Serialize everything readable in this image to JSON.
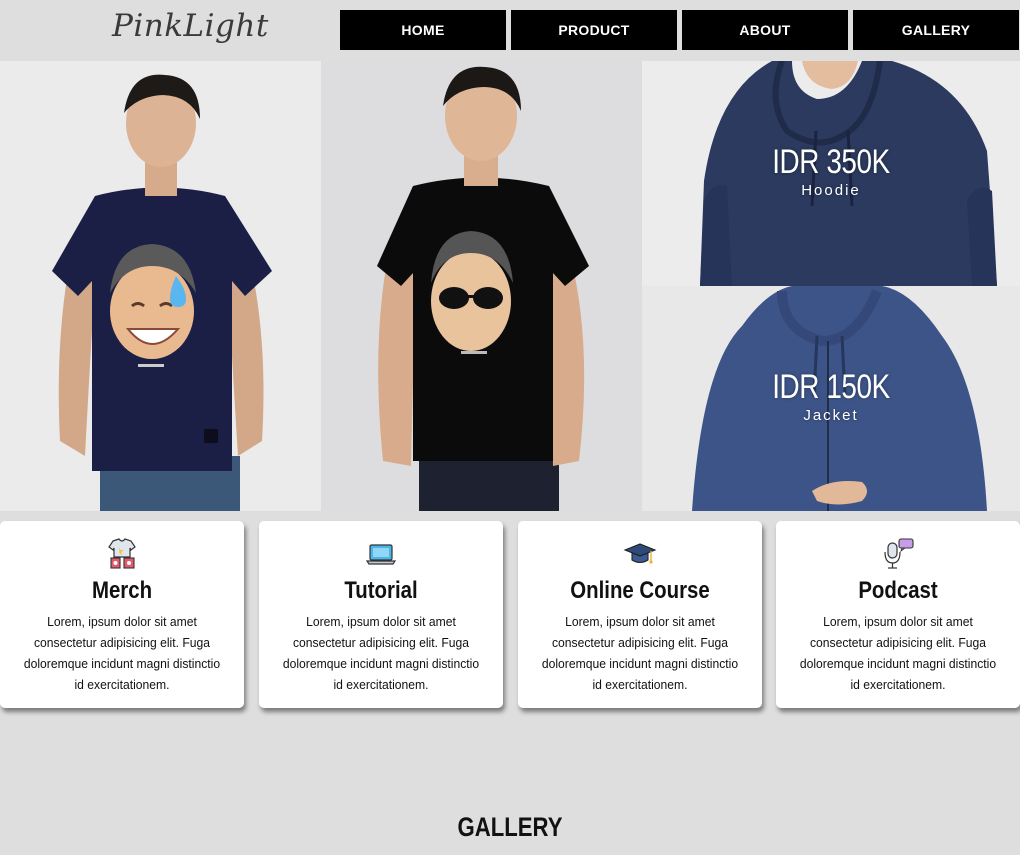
{
  "header": {
    "logo": "PinkLight"
  },
  "nav": {
    "items": [
      {
        "label": "HOME"
      },
      {
        "label": "PRODUCT"
      },
      {
        "label": "ABOUT"
      },
      {
        "label": "GALLERY"
      }
    ]
  },
  "hero": {
    "products": [
      {
        "price": "IDR 350K",
        "type": "Hoodie"
      },
      {
        "price": "IDR 150K",
        "type": "Jacket"
      }
    ]
  },
  "cards": [
    {
      "title": "Merch",
      "icon": "merch-icon",
      "description": "Lorem, ipsum dolor sit amet consectetur adipisicing elit. Fuga doloremque incidunt magni distinctio id exercitationem."
    },
    {
      "title": "Tutorial",
      "icon": "laptop-icon",
      "description": "Lorem, ipsum dolor sit amet consectetur adipisicing elit. Fuga doloremque incidunt magni distinctio id exercitationem."
    },
    {
      "title": "Online Course",
      "icon": "graduation-cap-icon",
      "description": "Lorem, ipsum dolor sit amet consectetur adipisicing elit. Fuga doloremque incidunt magni distinctio id exercitationem."
    },
    {
      "title": "Podcast",
      "icon": "microphone-icon",
      "description": "Lorem, ipsum dolor sit amet consectetur adipisicing elit. Fuga doloremque incidunt magni distinctio id exercitationem."
    }
  ],
  "gallery": {
    "title": "GALLERY"
  },
  "colors": {
    "nav_bg": "#000000",
    "page_bg": "#dedede",
    "card_bg": "#ffffff"
  }
}
